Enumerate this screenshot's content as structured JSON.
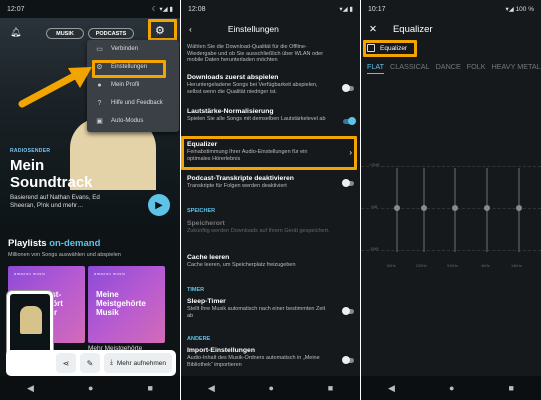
{
  "panel1": {
    "status_time": "12:07",
    "status_icons": "☾ ▾◢ ▮",
    "tabs": [
      "MUSIK",
      "PODCASTS"
    ],
    "menu_items": [
      {
        "icon": "cast-icon",
        "label": "Verbinden"
      },
      {
        "icon": "gear-icon",
        "label": "Einstellungen"
      },
      {
        "icon": "person-icon",
        "label": "Mein Profil"
      },
      {
        "icon": "help-icon",
        "label": "Hilfe und Feedback"
      },
      {
        "icon": "car-icon",
        "label": "Auto-Modus"
      }
    ],
    "kicker": "RADIOSENDER",
    "title": "Mein Soundtrack",
    "subtitle": "Basierend auf Nathan Evans, Ed Sheeran, P!nk und mehr…",
    "playlists_title": "Playlists",
    "playlists_highlight": "on-demand",
    "playlists_sub": "Millionen von Songs auswählen und abspielen",
    "tiles": [
      {
        "label": "Meist-\ngehört\nMehr",
        "caption": ""
      },
      {
        "label": "Meine\nMeistgehörte\nMusik",
        "caption": "Mehr Meistgehörte"
      }
    ],
    "tile_brand": "amazon music",
    "mehr_button": "Mehr aufnehmen"
  },
  "panel2": {
    "status_time": "12:08",
    "status_icons": "▾◢ ▮",
    "title": "Einstellungen",
    "intro": "Wählen Sie die Download-Qualität für die Offline-Wiedergabe und ob Sie ausschließlich über WLAN oder mobile Daten herunterladen möchten",
    "items": [
      {
        "title": "Downloads zuerst abspielen",
        "desc": "Heruntergeladene Songs bei Verfügbarkeit abspielen, selbst wenn die Qualität niedriger ist."
      },
      {
        "title": "Lautstärke-Normalisierung",
        "desc": "Spielen Sie alle Songs mit demselben Lautstärkelevel ab"
      },
      {
        "title": "Equalizer",
        "desc": "Feinabstimmung Ihrer Audio-Einstellungen für ein optimales Hörerlebnis"
      },
      {
        "title": "Podcast-Transkripte deaktivieren",
        "desc": "Transkripte für Folgen werden deaktiviert"
      }
    ],
    "section_speicher": "SPEICHER",
    "speicherort": {
      "title": "Speicherort",
      "desc": "Zukünftig werden Downloads auf Ihrem Gerät gespeichert."
    },
    "cache": {
      "title": "Cache leeren",
      "desc": "Cache leeren, um Speicherplatz freizugeben"
    },
    "section_timer": "TIMER",
    "sleep": {
      "title": "Sleep-Timer",
      "desc": "Stellt Ihre Musik automatisch nach einer bestimmten Zeit ab"
    },
    "section_andere": "ANDERE",
    "import": {
      "title": "Import-Einstellungen",
      "desc": "Audio-Inhalt des Musik-Ordners automatisch in „Meine Bibliothek“ importieren"
    }
  },
  "panel3": {
    "status_time": "10:17",
    "status_icons": "▾◢ 100 %",
    "title": "Equalizer",
    "checkbox_label": "Equalizer",
    "presets": [
      "FLAT",
      "CLASSICAL",
      "DANCE",
      "FOLK",
      "HEAVY METAL"
    ],
    "db_labels": [
      "+15dB",
      "0dB",
      "-15dB"
    ],
    "freqs": [
      "60Hz",
      "230Hz",
      "910Hz",
      "4kHz",
      "14kHz"
    ]
  },
  "nav": [
    "◀",
    "●",
    "■"
  ],
  "accent_color": "#f2a500",
  "link_color": "#5fc3e8"
}
